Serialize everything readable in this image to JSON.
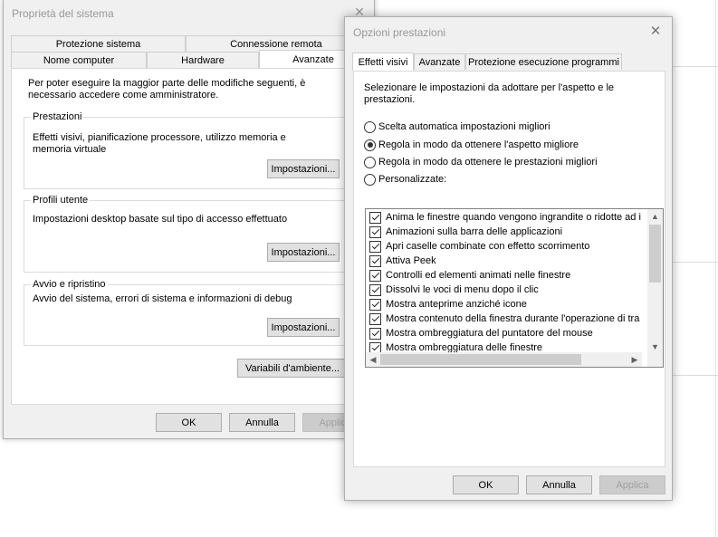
{
  "system_properties": {
    "title": "Proprietà del sistema",
    "tabs_top": [
      "Protezione sistema",
      "Connessione remota"
    ],
    "tabs_bottom": [
      "Nome computer",
      "Hardware",
      "Avanzate"
    ],
    "intro": "Per poter eseguire la maggior parte delle modifiche seguenti, è necessario accedere come amministratore.",
    "performance": {
      "legend": "Prestazioni",
      "text": "Effetti visivi, pianificazione processore, utilizzo memoria e memoria virtuale",
      "button": "Impostazioni..."
    },
    "profiles": {
      "legend": "Profili utente",
      "text": "Impostazioni desktop basate sul tipo di accesso effettuato",
      "button": "Impostazioni..."
    },
    "startup": {
      "legend": "Avvio e ripristino",
      "text": "Avvio del sistema, errori di sistema e informazioni di debug",
      "button": "Impostazioni..."
    },
    "env_button": "Variabili d'ambiente...",
    "ok": "OK",
    "cancel": "Annulla",
    "apply": "Applica"
  },
  "performance_options": {
    "title": "Opzioni prestazioni",
    "tabs": [
      "Effetti visivi",
      "Avanzate",
      "Protezione esecuzione programmi"
    ],
    "description": "Selezionare le impostazioni da adottare per l'aspetto e le prestazioni.",
    "radios": [
      {
        "label": "Scelta automatica impostazioni migliori",
        "checked": false
      },
      {
        "label": "Regola in modo da ottenere l'aspetto migliore",
        "checked": true
      },
      {
        "label": "Regola in modo da ottenere le prestazioni migliori",
        "checked": false
      },
      {
        "label": "Personalizzate:",
        "checked": false
      }
    ],
    "effects": [
      "Anima le finestre quando vengono ingrandite o ridotte ad i",
      "Animazioni sulla barra delle applicazioni",
      "Apri caselle combinate con effetto scorrimento",
      "Attiva Peek",
      "Controlli ed elementi animati nelle finestre",
      "Dissolvi le voci di menu dopo il clic",
      "Mostra anteprime anziché icone",
      "Mostra contenuto della finestra durante l'operazione di tra",
      "Mostra ombreggiatura del puntatore del mouse",
      "Mostra ombreggiatura delle finestre"
    ],
    "ok": "OK",
    "cancel": "Annulla",
    "apply": "Applica"
  }
}
